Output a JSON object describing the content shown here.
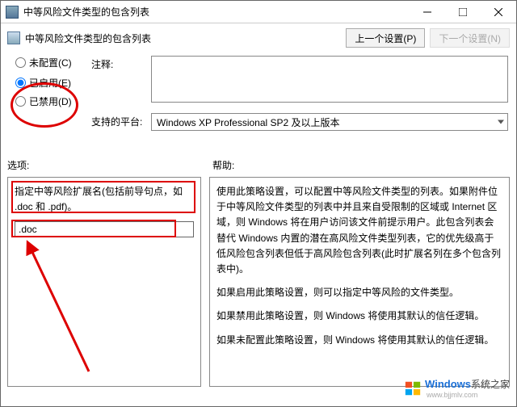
{
  "titlebar": {
    "title": "中等风险文件类型的包含列表"
  },
  "subheader": {
    "title": "中等风险文件类型的包含列表",
    "prev_btn": "上一个设置(P)",
    "next_btn": "下一个设置(N)"
  },
  "config": {
    "not_configured": "未配置(C)",
    "enabled": "已启用(E)",
    "disabled": "已禁用(D)",
    "annotation_label": "注释:",
    "platform_label": "支持的平台:",
    "platform_value": "Windows XP Professional SP2 及以上版本"
  },
  "sections": {
    "options": "选项:",
    "help": "帮助:"
  },
  "left_panel": {
    "instruction": "指定中等风险扩展名(包括前导句点，如 .doc 和 .pdf)。",
    "input_value": ".doc"
  },
  "help_text": {
    "p1": "使用此策略设置，可以配置中等风险文件类型的列表。如果附件位于中等风险文件类型的列表中并且来自受限制的区域或 Internet 区域，则 Windows 将在用户访问该文件前提示用户。此包含列表会替代 Windows 内置的潜在高风险文件类型列表，它的优先级高于低风险包含列表但低于高风险包含列表(此时扩展名列在多个包含列表中)。",
    "p2": "如果启用此策略设置，则可以指定中等风险的文件类型。",
    "p3": "如果禁用此策略设置，则 Windows 将使用其默认的信任逻辑。",
    "p4": "如果未配置此策略设置，则 Windows 将使用其默认的信任逻辑。"
  },
  "watermark": {
    "brand": "Windows",
    "suffix": "系统之家",
    "url": "www.bjjmlv.com"
  }
}
